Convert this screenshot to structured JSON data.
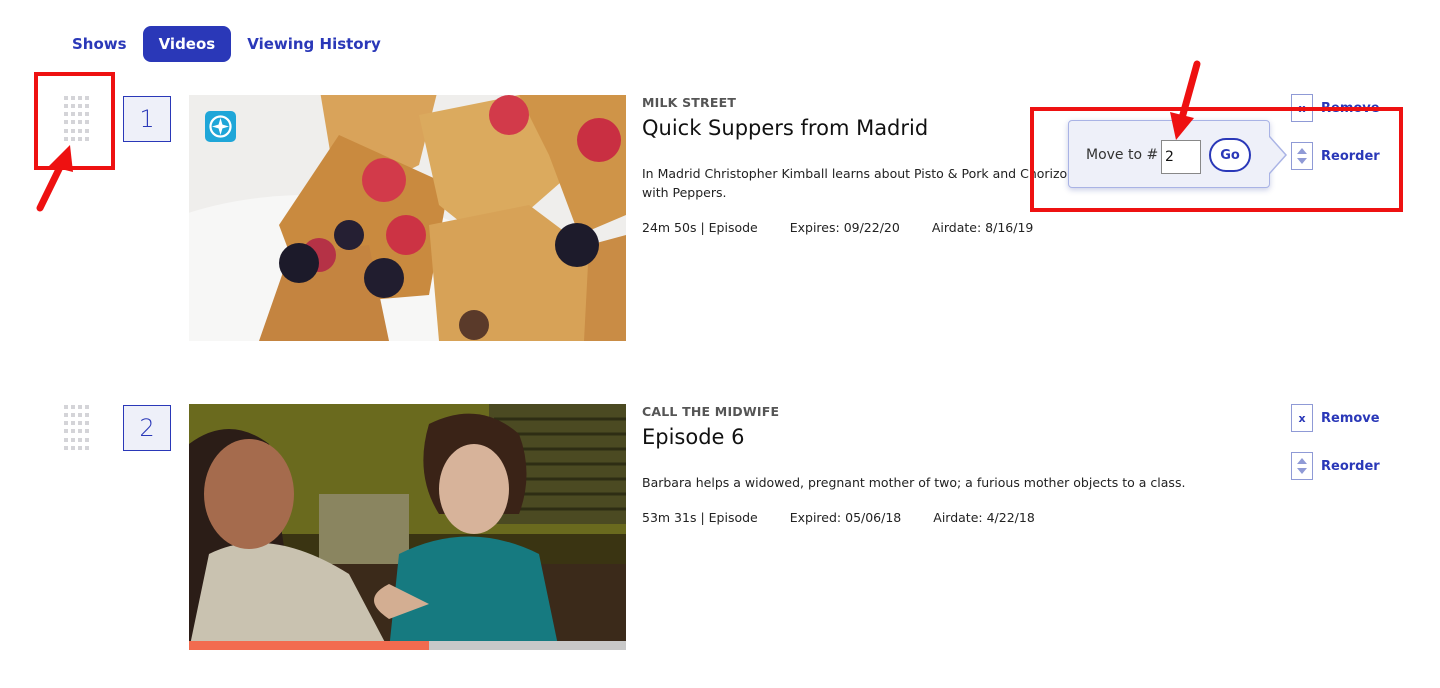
{
  "tabs": [
    {
      "label": "Shows",
      "active": false
    },
    {
      "label": "Videos",
      "active": true
    },
    {
      "label": "Viewing History",
      "active": false
    }
  ],
  "items": [
    {
      "rank": "1",
      "show": "MILK STREET",
      "title": "Quick Suppers from Madrid",
      "description": "In Madrid Christopher Kimball learns about Pisto & Pork and Chorizo with Peppers.",
      "duration": "24m 50s | Episode",
      "expires": "Expires: 09/22/20",
      "airdate": "Airdate: 8/16/19",
      "badge_icon": "compass-icon",
      "remove_label": "Remove",
      "reorder_label": "Reorder"
    },
    {
      "rank": "2",
      "show": "CALL THE MIDWIFE",
      "title": "Episode 6",
      "description": "Barbara helps a widowed, pregnant mother of two; a furious mother objects to a class.",
      "duration": "53m 31s | Episode",
      "expires": "Expired: 05/06/18",
      "airdate": "Airdate: 4/22/18",
      "remove_label": "Remove",
      "reorder_label": "Reorder",
      "watch_progress": 0.55
    }
  ],
  "reorder_popover": {
    "label": "Move to #",
    "value": "2",
    "go_label": "Go"
  },
  "colors": {
    "accent": "#2a38b8",
    "annotation": "#ee1111",
    "progress": "#f26b4f"
  }
}
